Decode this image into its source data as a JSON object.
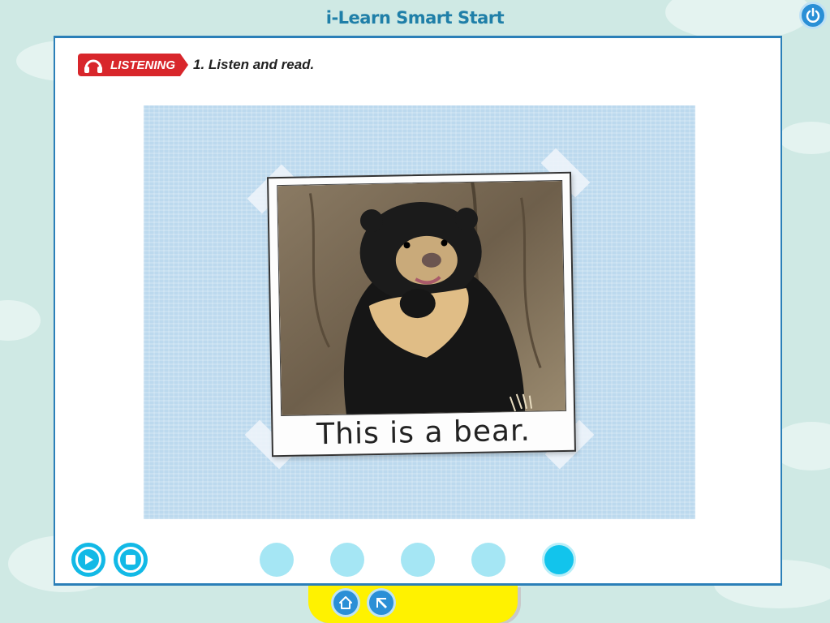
{
  "app": {
    "title": "i-Learn Smart Start"
  },
  "toolbar": {
    "power_icon": "power-icon"
  },
  "activity": {
    "badge_label": "LISTENING",
    "badge_icon": "headphones-icon",
    "instruction": "1. Listen and read."
  },
  "card": {
    "caption": "This is a bear.",
    "image": "sun-bear-photo"
  },
  "player": {
    "play_icon": "play-icon",
    "stop_icon": "stop-icon",
    "page_dots": 5,
    "active_page": 5
  },
  "bottom_nav": {
    "home_icon": "home-icon",
    "back_icon": "back-arrow-icon"
  },
  "colors": {
    "background": "#cfe9e4",
    "accent": "#12b9e6",
    "title": "#1f7fa8",
    "badge": "#d8262b",
    "nav_bar": "#fff200"
  }
}
